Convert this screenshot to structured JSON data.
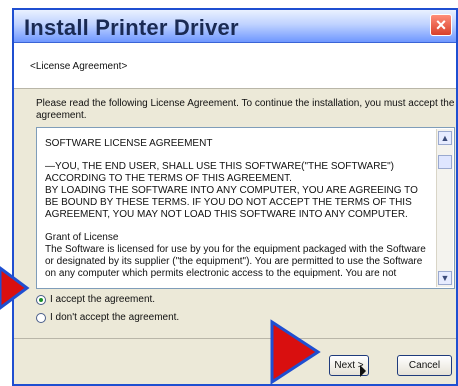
{
  "window": {
    "title": "Install Printer Driver",
    "close_glyph": "×"
  },
  "header": {
    "section_title": "<License Agreement>"
  },
  "intro_text": "Please read the following License Agreement. To continue the installation, you must accept the agreement.",
  "license": {
    "heading": "SOFTWARE LICENSE AGREEMENT",
    "para1": "—YOU, THE END USER, SHALL USE THIS SOFTWARE(\"THE SOFTWARE\") ACCORDING TO THE TERMS OF THIS AGREEMENT.\nBY LOADING THE SOFTWARE INTO ANY COMPUTER, YOU ARE AGREEING TO BE BOUND BY THESE TERMS. IF YOU DO NOT ACCEPT THE TERMS OF THIS AGREEMENT, YOU MAY NOT LOAD THIS SOFTWARE INTO ANY COMPUTER.",
    "grant_title": "Grant of License",
    "grant_text": "The Software is licensed for use by you for the equipment packaged with the Software or designated by its supplier (\"the equipment\"). You are permitted to use the Software on any computer which permits electronic access to the equipment. You are not"
  },
  "options": {
    "accept": "I accept the agreement.",
    "decline": "I don't accept the agreement.",
    "selected": "accept"
  },
  "buttons": {
    "next": "Next >",
    "cancel": "Cancel"
  },
  "colors": {
    "title_bar": "#6f97ff",
    "close": "#d8402a",
    "dialog_bg": "#ece9d8",
    "annotation_arrow": "#d90f0f"
  },
  "icons": {
    "close": "close-icon",
    "scroll_up": "scroll-up-icon",
    "scroll_down": "scroll-down-icon",
    "cursor": "mouse-pointer-icon",
    "pointer_arrow": "red-pointer-arrow-icon"
  }
}
